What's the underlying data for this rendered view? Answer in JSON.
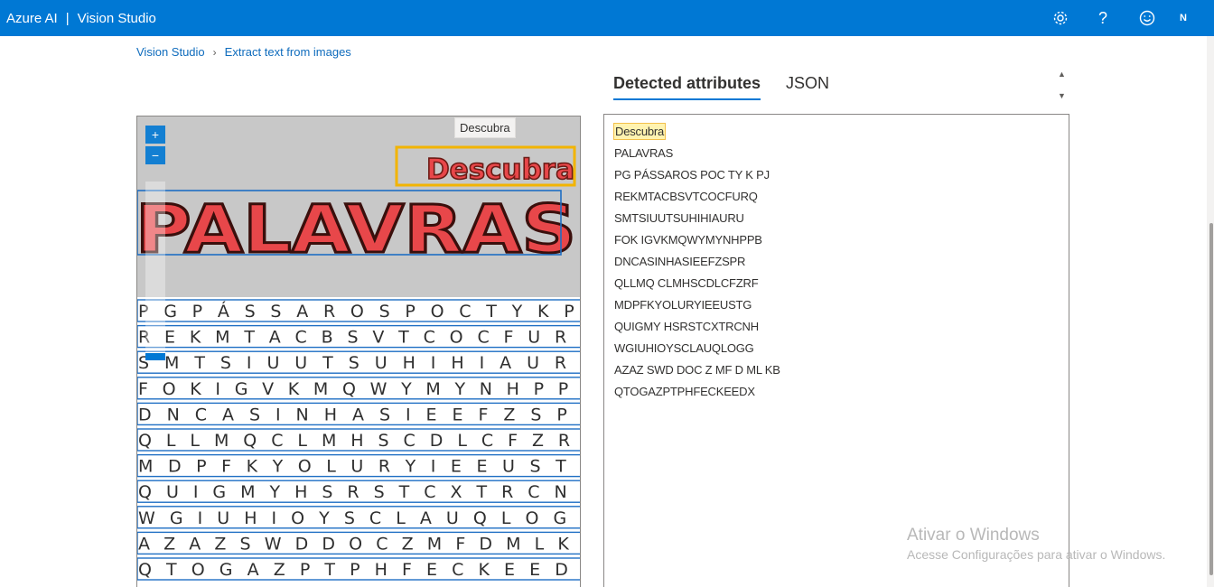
{
  "header": {
    "brand": "Azure AI",
    "separator": "|",
    "product": "Vision Studio",
    "icons": [
      "gear-icon",
      "help-icon",
      "feedback-smiley-icon"
    ],
    "avatar_initial": "N"
  },
  "breadcrumb": {
    "items": [
      "Vision Studio",
      "Extract text from images"
    ]
  },
  "viewer": {
    "tooltip": "Descubra",
    "zoom_in": "+",
    "zoom_out": "−",
    "heading_small": "Descubra",
    "heading_large": "PALAVRAS",
    "grid_rows": [
      "P G P Á S S A R O S P O C T Y K P J",
      "R E K M T A C B S V T C O C F U R Q",
      "S M T S I U U T S U H I H I A U R U",
      "F O K I G V K M Q W Y M Y N H P P B",
      "D N C A S I N H A S I E E F Z S P R",
      "Q L L M Q C L M H S C D L C F Z R F",
      "M D P F K Y O L U R Y I E E U S T G",
      "Q U I G M Y H S R S T C X T R C N H",
      "W G I U H I O Y S C L A U Q L O G G",
      "A Z A Z S W D D O C Z M F D M L K B",
      "Q T O G A Z P T P H F E C K E E D X"
    ]
  },
  "tabs": [
    {
      "label": "Detected attributes",
      "active": true
    },
    {
      "label": "JSON",
      "active": false
    }
  ],
  "results": {
    "selected_index": 0,
    "lines": [
      "Descubra",
      "PALAVRAS",
      "PG PÁSSAROS POC TY K PJ",
      "REKMTACBSVTCOCFURQ",
      "SMTSIUUTSUHIHIAURU",
      "FOK IGVKMQWYMYNHPPB",
      "DNCASINHASIEEFZSPR",
      "QLLMQ CLMHSCDLCFZRF",
      "MDPFKYOLURYIEEUSTG",
      "QUIGMY HSRSTCXTRCNH",
      "WGIUHIOYSCLAUQLOGG",
      "AZAZ SWD DOC Z MF D ML KB",
      "QTOGAZPTPHFECKEEDX"
    ]
  },
  "watermark": {
    "title": "Ativar o Windows",
    "subtitle": "Acesse Configurações para ativar o Windows."
  },
  "colors": {
    "brand_bar": "#0078d4",
    "box_stroke": "#1f6fc4",
    "selected_box": "#f2b400",
    "heading_red": "#e8474a"
  }
}
